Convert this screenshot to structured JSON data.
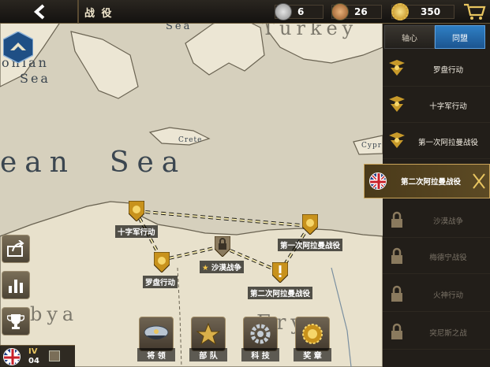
{
  "header": {
    "title": "战 役",
    "resources": [
      {
        "icon": "silver-medal-icon",
        "value": "6"
      },
      {
        "icon": "bronze-medal-icon",
        "value": "26"
      },
      {
        "icon": "gold-sun-coin-icon",
        "value": "350"
      }
    ]
  },
  "map": {
    "sea_labels": [
      "Sea",
      "Turkey",
      "onian",
      "Sea",
      "ean  Sea",
      "Crete",
      "Cypr",
      "bya",
      "Ery"
    ],
    "markers": [
      {
        "label": "十字军行动",
        "state": "unlocked"
      },
      {
        "label": "罗盘行动",
        "state": "unlocked"
      },
      {
        "label": "沙漠战争",
        "state": "locked",
        "starred": true
      },
      {
        "label": "第一次阿拉曼战役",
        "state": "unlocked"
      },
      {
        "label": "第二次阿拉曼战役",
        "state": "current"
      }
    ]
  },
  "panel": {
    "tabs": [
      {
        "label": "轴心",
        "active": false
      },
      {
        "label": "同盟",
        "active": true
      }
    ],
    "operations": [
      {
        "label": "罗盘行动",
        "state": "unlocked"
      },
      {
        "label": "十字军行动",
        "state": "unlocked"
      },
      {
        "label": "第一次阿拉曼战役",
        "state": "unlocked"
      },
      {
        "label": "第二次阿拉曼战役",
        "state": "active"
      },
      {
        "label": "沙漠战争",
        "state": "locked"
      },
      {
        "label": "梅德宁战役",
        "state": "locked"
      },
      {
        "label": "火神行动",
        "state": "locked"
      },
      {
        "label": "突尼斯之战",
        "state": "locked"
      }
    ]
  },
  "bottom_bar": [
    {
      "label": "将 领",
      "icon": "officer-cap-icon"
    },
    {
      "label": "部 队",
      "icon": "army-star-icon"
    },
    {
      "label": "科 技",
      "icon": "gear-wrench-icon"
    },
    {
      "label": "奖 章",
      "icon": "medal-icon"
    }
  ],
  "side_buttons": [
    "share-icon",
    "stats-icon",
    "trophy-icon"
  ],
  "player": {
    "rank": "IV",
    "level": "04"
  },
  "colors": {
    "accent_blue": "#2f7fc4",
    "gold": "#caa45a",
    "sea": "#d6d0bd",
    "land": "#ece6d4"
  }
}
